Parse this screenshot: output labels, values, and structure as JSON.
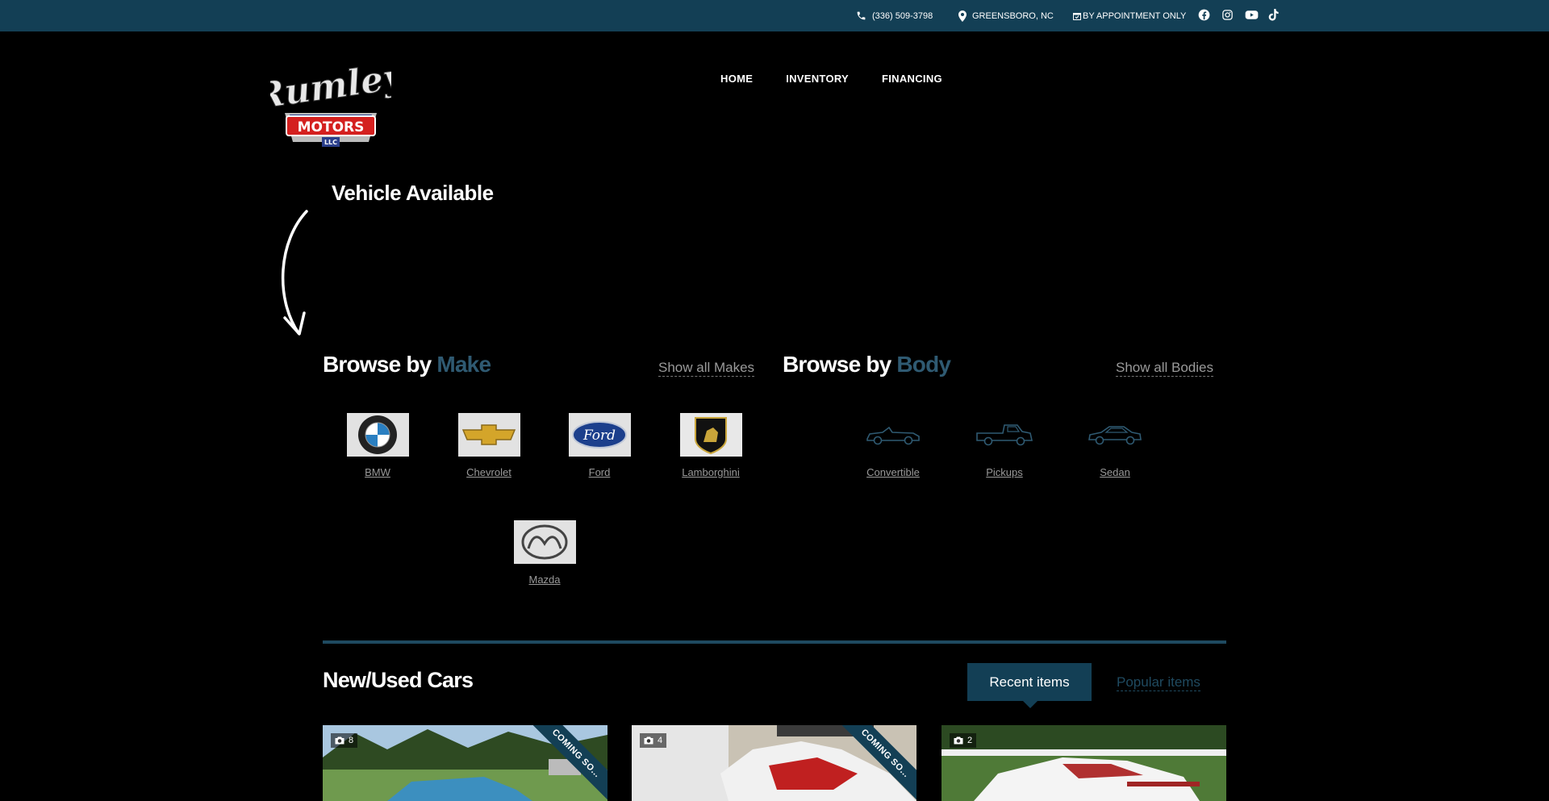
{
  "topbar": {
    "phone": "(336) 509-3798",
    "location": "GREENSBORO, NC",
    "hours": "BY APPOINTMENT ONLY",
    "social": [
      "facebook-icon",
      "instagram-icon",
      "youtube-icon",
      "tiktok-icon"
    ]
  },
  "logo": {
    "script": "Rumley",
    "main": "MOTORS",
    "sub": "LLC"
  },
  "nav": {
    "home": "HOME",
    "inventory": "INVENTORY",
    "financing": "FINANCING"
  },
  "hero": {
    "title": "Vehicle Available"
  },
  "browse_make": {
    "title_prefix": "Browse by",
    "title_accent": "Make",
    "show_all": "Show all Makes",
    "items": [
      {
        "label": "BMW"
      },
      {
        "label": "Chevrolet"
      },
      {
        "label": "Ford"
      },
      {
        "label": "Lamborghini"
      },
      {
        "label": "Mazda"
      }
    ]
  },
  "browse_body": {
    "title_prefix": "Browse by",
    "title_accent": "Body",
    "show_all": "Show all Bodies",
    "items": [
      {
        "label": "Convertible"
      },
      {
        "label": "Pickups"
      },
      {
        "label": "Sedan"
      }
    ]
  },
  "listings": {
    "title": "New/Used Cars",
    "tab_recent": "Recent items",
    "tab_popular": "Popular items",
    "cards": [
      {
        "photos": "8",
        "ribbon": "COMING SO..."
      },
      {
        "photos": "4",
        "ribbon": "COMING SO..."
      },
      {
        "photos": "2",
        "ribbon": ""
      }
    ]
  },
  "colors": {
    "topbar": "#133f55",
    "accent": "#2f5a72",
    "background": "#000000"
  }
}
